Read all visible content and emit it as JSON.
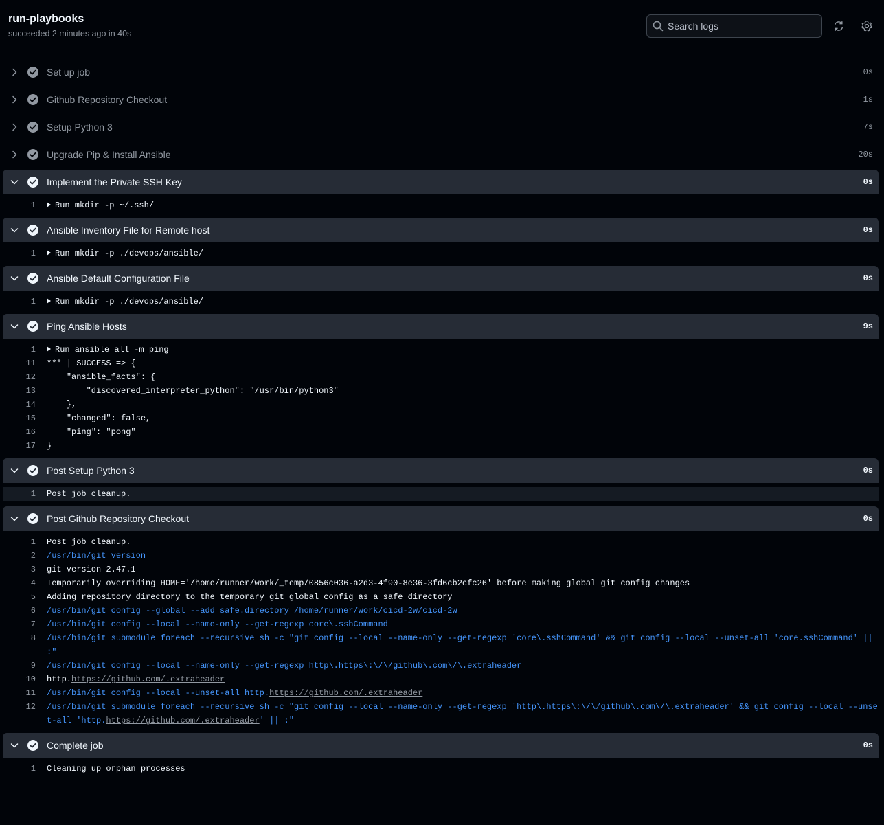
{
  "header": {
    "title": "run-playbooks",
    "subtitle": "succeeded 2 minutes ago in 40s",
    "search_placeholder": "Search logs"
  },
  "colors": {
    "success": "#9198a1",
    "accent_link": "#4493f8",
    "bg": "#010409",
    "expanded_bg": "#262c36"
  },
  "steps": [
    {
      "name": "Set up job",
      "duration": "0s",
      "expanded": false
    },
    {
      "name": "Github Repository Checkout",
      "duration": "1s",
      "expanded": false
    },
    {
      "name": "Setup Python 3",
      "duration": "7s",
      "expanded": false
    },
    {
      "name": "Upgrade Pip & Install Ansible",
      "duration": "20s",
      "expanded": false
    },
    {
      "name": "Implement the Private SSH Key",
      "duration": "0s",
      "expanded": true,
      "lines": [
        {
          "n": "1",
          "text": "Run mkdir -p ~/.ssh/",
          "group": true
        }
      ]
    },
    {
      "name": "Ansible Inventory File for Remote host",
      "duration": "0s",
      "expanded": true,
      "lines": [
        {
          "n": "1",
          "text": "Run mkdir -p ./devops/ansible/",
          "group": true
        }
      ]
    },
    {
      "name": "Ansible Default Configuration File",
      "duration": "0s",
      "expanded": true,
      "lines": [
        {
          "n": "1",
          "text": "Run mkdir -p ./devops/ansible/",
          "group": true
        }
      ]
    },
    {
      "name": "Ping Ansible Hosts",
      "duration": "9s",
      "expanded": true,
      "lines": [
        {
          "n": "1",
          "text": "Run ansible all -m ping",
          "group": true
        },
        {
          "n": "11",
          "text": "*** | SUCCESS => {"
        },
        {
          "n": "12",
          "text": "    \"ansible_facts\": {"
        },
        {
          "n": "13",
          "text": "        \"discovered_interpreter_python\": \"/usr/bin/python3\""
        },
        {
          "n": "14",
          "text": "    },"
        },
        {
          "n": "15",
          "text": "    \"changed\": false,"
        },
        {
          "n": "16",
          "text": "    \"ping\": \"pong\""
        },
        {
          "n": "17",
          "text": "}"
        }
      ]
    },
    {
      "name": "Post Setup Python 3",
      "duration": "0s",
      "expanded": true,
      "lines": [
        {
          "n": "1",
          "text": "Post job cleanup.",
          "highlight": true
        }
      ]
    },
    {
      "name": "Post Github Repository Checkout",
      "duration": "0s",
      "expanded": true,
      "lines": [
        {
          "n": "1",
          "text": "Post job cleanup."
        },
        {
          "n": "2",
          "text": "/usr/bin/git version",
          "cmd": true
        },
        {
          "n": "3",
          "text": "git version 2.47.1"
        },
        {
          "n": "4",
          "text": "Temporarily overriding HOME='/home/runner/work/_temp/0856c036-a2d3-4f90-8e36-3fd6cb2cfc26' before making global git config changes"
        },
        {
          "n": "5",
          "text": "Adding repository directory to the temporary git global config as a safe directory"
        },
        {
          "n": "6",
          "text": "/usr/bin/git config --global --add safe.directory /home/runner/work/cicd-2w/cicd-2w",
          "cmd": true
        },
        {
          "n": "7",
          "text": "/usr/bin/git config --local --name-only --get-regexp core\\.sshCommand",
          "cmd": true
        },
        {
          "n": "8",
          "text": "/usr/bin/git submodule foreach --recursive sh -c \"git config --local --name-only --get-regexp 'core\\.sshCommand' && git config --local --unset-all 'core.sshCommand' || :\"",
          "cmd": true
        },
        {
          "n": "9",
          "text": "/usr/bin/git config --local --name-only --get-regexp http\\.https\\:\\/\\/github\\.com\\/\\.extraheader",
          "cmd": true
        },
        {
          "n": "10",
          "text": "http.",
          "link": "https://github.com/.extraheader",
          "after": ""
        },
        {
          "n": "11",
          "text": "/usr/bin/git config --local --unset-all http.",
          "link": "https://github.com/.extraheader",
          "after": "",
          "cmd": true
        },
        {
          "n": "12",
          "text": "/usr/bin/git submodule foreach --recursive sh -c \"git config --local --name-only --get-regexp 'http\\.https\\:\\/\\/github\\.com\\/\\.extraheader' && git config --local --unset-all 'http.",
          "link": "https://github.com/.extraheader",
          "after": "' || :\"",
          "cmd": true
        }
      ]
    },
    {
      "name": "Complete job",
      "duration": "0s",
      "expanded": true,
      "lines": [
        {
          "n": "1",
          "text": "Cleaning up orphan processes"
        }
      ]
    }
  ]
}
